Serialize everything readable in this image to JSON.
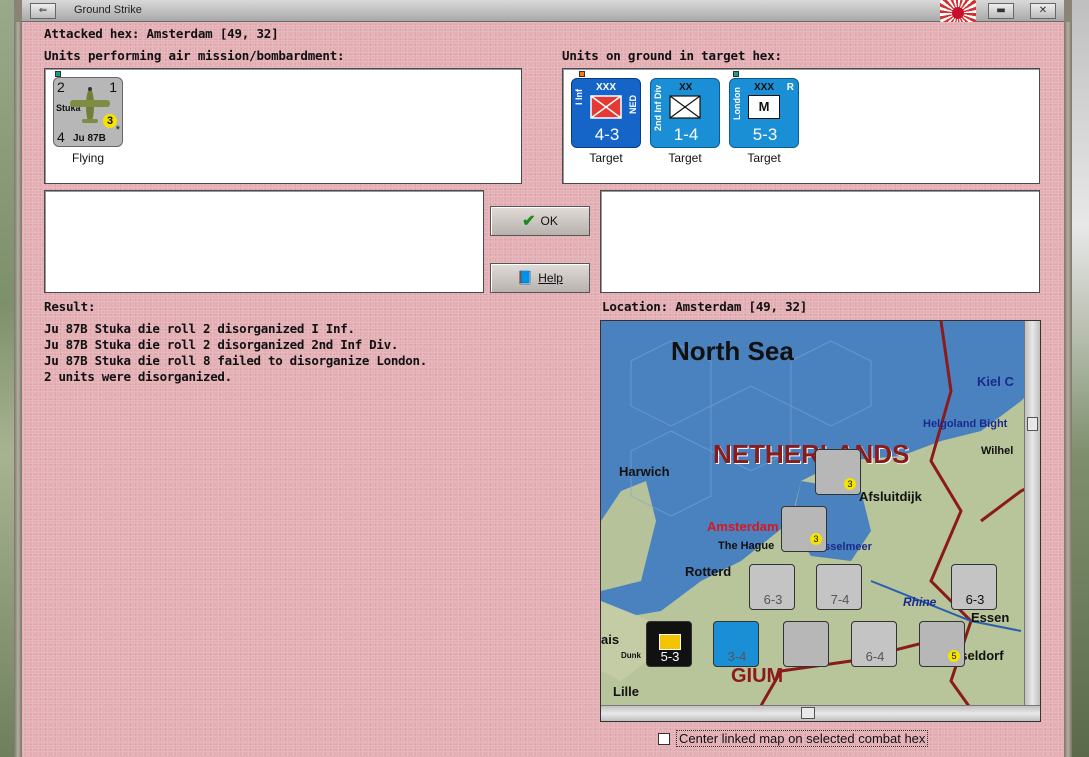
{
  "window": {
    "title": "Ground Strike"
  },
  "header": {
    "attacked_hex": "Attacked hex: Amsterdam [49, 32]",
    "air_units_label": "Units performing air mission/bombardment:",
    "ground_units_label": "Units on ground in target hex:"
  },
  "air_units": [
    {
      "name": "Stuka",
      "type": "Ju 87B",
      "top_left": "2",
      "top_right": "1",
      "bottom_left": "4",
      "badge": "3",
      "star": "*",
      "status": "Flying"
    }
  ],
  "ground_units": [
    {
      "name": "I Inf",
      "size": "XXX",
      "nation": "NED",
      "strength": "4-3",
      "status": "Target",
      "color": "#1565c8"
    },
    {
      "name": "2nd Inf Div",
      "size": "XX",
      "nation": "",
      "strength": "1-4",
      "status": "Target",
      "color": "#1a8fd6"
    },
    {
      "name": "London",
      "size": "XXX",
      "nation": "R",
      "strength": "5-3",
      "status": "Target",
      "color": "#1a8fd6",
      "symbol": "M"
    }
  ],
  "buttons": {
    "ok": "OK",
    "help": "Help"
  },
  "result": {
    "label": "Result:",
    "lines": [
      "Ju 87B Stuka die roll 2 disorganized I Inf.",
      "Ju 87B Stuka die roll 2 disorganized 2nd Inf Div.",
      "Ju 87B Stuka die roll 8 failed to disorganize London.",
      "2 units were disorganized."
    ]
  },
  "location": {
    "label": "Location:  Amsterdam  [49, 32]",
    "map_labels": {
      "sea": "North Sea",
      "country": "NETHERLANDS",
      "harwich": "Harwich",
      "amsterdam": "Amsterdam",
      "hague": "The Hague",
      "rotterdam": "Rotterd",
      "kiel": "Kiel C",
      "helgoland": "Helgoland Bight",
      "wilhel": "Wilhel",
      "afsluitdijk": "Afsluitdijk",
      "ijsselmeer": "IJsselmeer",
      "rhine": "Rhine",
      "essen": "Essen",
      "duss": "sseldorf",
      "lille": "Lille",
      "ais": "ais",
      "dunk": "Dunk",
      "bel": "GIUM"
    },
    "counters": [
      {
        "label": "6-3",
        "kind": "grey"
      },
      {
        "label": "7-4",
        "kind": "grey"
      },
      {
        "label": "6-3",
        "kind": "grey"
      },
      {
        "label": "5-3",
        "kind": "black"
      },
      {
        "label": "3-4",
        "kind": "blue"
      },
      {
        "label": "6-4",
        "kind": "grey"
      }
    ]
  },
  "footer": {
    "center_linked_map": "Center linked map on selected combat hex"
  }
}
